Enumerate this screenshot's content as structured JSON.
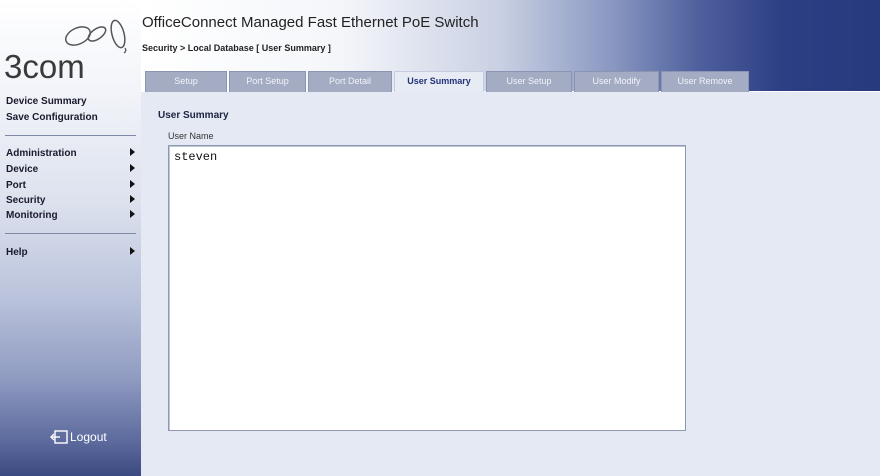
{
  "brand": {
    "logo_text": "3COM",
    "logo_icon": "3com-rings-logo"
  },
  "header": {
    "title": "OfficeConnect Managed Fast Ethernet PoE Switch",
    "breadcrumb": "Security > Local Database [ User Summary ]"
  },
  "sidebar": {
    "top_links": [
      "Device Summary",
      "Save Configuration"
    ],
    "menu": [
      {
        "label": "Administration",
        "icon": "arrow-right-icon"
      },
      {
        "label": "Device",
        "icon": "arrow-right-icon"
      },
      {
        "label": "Port",
        "icon": "arrow-right-icon"
      },
      {
        "label": "Security",
        "icon": "arrow-right-icon"
      },
      {
        "label": "Monitoring",
        "icon": "arrow-right-icon"
      }
    ],
    "help": {
      "label": "Help",
      "icon": "arrow-right-icon"
    },
    "logout": {
      "label": "Logout",
      "icon": "logout-icon"
    }
  },
  "tabs": [
    "Setup",
    "Port Setup",
    "Port Detail",
    "User Summary",
    "User Setup",
    "User Modify",
    "User Remove"
  ],
  "active_tab": "User Summary",
  "main": {
    "section_title": "User Summary",
    "field_label": "User Name",
    "users": [
      "steven"
    ]
  },
  "colors": {
    "header_dark": "#283a7e",
    "tab_inactive": "#a4acc4",
    "content_bg": "#e4e9f3",
    "active_tab_text": "#24337a"
  }
}
